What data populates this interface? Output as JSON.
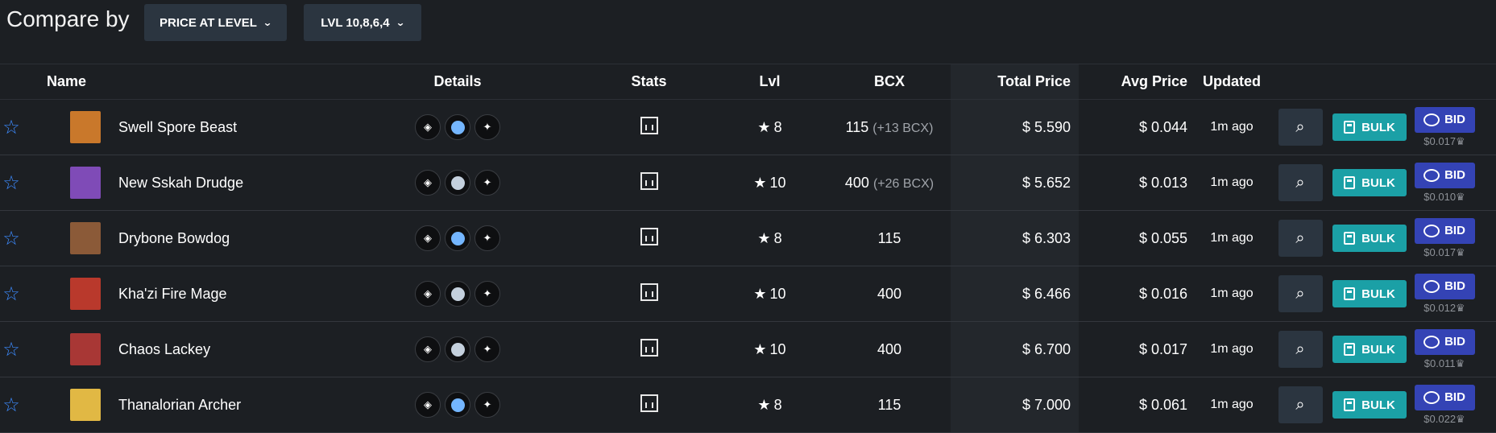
{
  "header": {
    "title": "Compare by",
    "dropdown_1": "PRICE AT LEVEL",
    "dropdown_2": "LVL 10,8,6,4"
  },
  "columns": [
    "Name",
    "Details",
    "Stats",
    "Lvl",
    "BCX",
    "Total Price",
    "Avg Price",
    "Updated"
  ],
  "buttons": {
    "bulk": "BULK",
    "bid": "BID"
  },
  "colors": {
    "background": "#1c1f23",
    "dark_button": "#2b3540",
    "bulk": "#1ba0a6",
    "bid": "#3443b5",
    "favorite": "#3d8bff"
  },
  "rows": [
    {
      "name": "Swell Spore Beast",
      "level": "8",
      "bcx": "115",
      "bcx_extra": "(+13 BCX)",
      "total_price": "$ 5.590",
      "avg_price": "$ 0.044",
      "updated": "1m ago",
      "bid_price": "$0.017",
      "element_color": "#74b6ff",
      "element_icon": "leaf-icon",
      "avatar_color": "#c9782b"
    },
    {
      "name": "New Sskah Drudge",
      "level": "10",
      "bcx": "400",
      "bcx_extra": "(+26 BCX)",
      "total_price": "$ 5.652",
      "avg_price": "$ 0.013",
      "updated": "1m ago",
      "bid_price": "$0.010",
      "element_color": "#c4d0dd",
      "element_icon": "skull-icon",
      "avatar_color": "#7f4bb7"
    },
    {
      "name": "Drybone Bowdog",
      "level": "8",
      "bcx": "115",
      "bcx_extra": "",
      "total_price": "$ 6.303",
      "avg_price": "$ 0.055",
      "updated": "1m ago",
      "bid_price": "$0.017",
      "element_color": "#74b6ff",
      "element_icon": "crossed-swords-icon",
      "avatar_color": "#8b5a38"
    },
    {
      "name": "Kha'zi Fire Mage",
      "level": "10",
      "bcx": "400",
      "bcx_extra": "",
      "total_price": "$ 6.466",
      "avg_price": "$ 0.016",
      "updated": "1m ago",
      "bid_price": "$0.012",
      "element_color": "#c4d0dd",
      "element_icon": "fire-icon",
      "avatar_color": "#b9392c"
    },
    {
      "name": "Chaos Lackey",
      "level": "10",
      "bcx": "400",
      "bcx_extra": "",
      "total_price": "$ 6.700",
      "avg_price": "$ 0.017",
      "updated": "1m ago",
      "bid_price": "$0.011",
      "element_color": "#c4d0dd",
      "element_icon": "crossed-swords-icon",
      "avatar_color": "#a83735"
    },
    {
      "name": "Thanalorian Archer",
      "level": "8",
      "bcx": "115",
      "bcx_extra": "",
      "total_price": "$ 7.000",
      "avg_price": "$ 0.061",
      "updated": "1m ago",
      "bid_price": "$0.022",
      "element_color": "#74b6ff",
      "element_icon": "sparkle-icon",
      "avatar_color": "#e1b844"
    }
  ]
}
